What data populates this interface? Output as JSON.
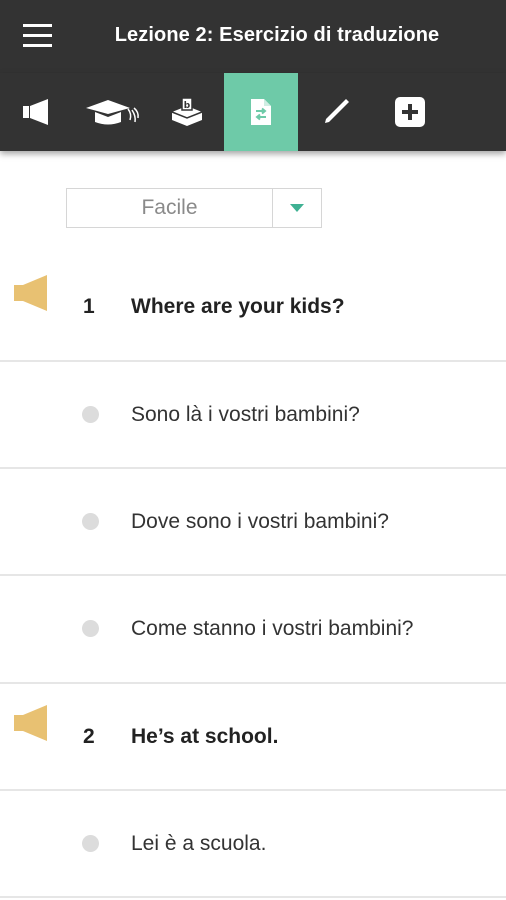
{
  "header": {
    "title": "Lezione 2: Esercizio di traduzione"
  },
  "toolbar": {
    "tools": [
      {
        "icon": "megaphone-icon"
      },
      {
        "icon": "graduation-cap-icon"
      },
      {
        "icon": "ballot-box-icon"
      },
      {
        "icon": "translate-document-icon",
        "active": true
      },
      {
        "icon": "pencil-icon"
      },
      {
        "icon": "plus-square-icon"
      }
    ],
    "active_color": "#6ecaa8",
    "background_color": "#333333"
  },
  "difficulty": {
    "value": "Facile",
    "arrow_color": "#3fb193"
  },
  "questions": [
    {
      "number": "1",
      "text": "Where are your kids?",
      "options": [
        "Sono là i vostri bambini?",
        "Dove sono i vostri bambini?",
        "Come stanno i vostri bambini?"
      ]
    },
    {
      "number": "2",
      "text": "He’s at school.",
      "options": [
        "Lei è a scuola."
      ]
    }
  ],
  "colors": {
    "speaker": "#e8c172",
    "radio": "#dcdcdc",
    "divider": "#e6e6e6"
  }
}
